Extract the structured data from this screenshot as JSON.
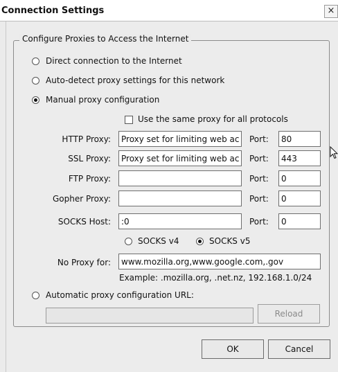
{
  "window": {
    "title": "Connection Settings",
    "close_glyph": "×"
  },
  "group_title": "Configure Proxies to Access the Internet",
  "options": {
    "direct": "Direct connection to the Internet",
    "autodetect": "Auto-detect proxy settings for this network",
    "manual": "Manual proxy configuration",
    "selected": "manual"
  },
  "same_proxy_label": "Use the same proxy for all protocols",
  "proxies": {
    "http": {
      "label": "HTTP Proxy:",
      "value": "Proxy set for limiting web ac",
      "port_label": "Port:",
      "port": "80"
    },
    "ssl": {
      "label": "SSL Proxy:",
      "value": "Proxy set for limiting web ac",
      "port_label": "Port:",
      "port": "443"
    },
    "ftp": {
      "label": "FTP Proxy:",
      "value": "",
      "port_label": "Port:",
      "port": "0"
    },
    "gopher": {
      "label": "Gopher Proxy:",
      "value": "",
      "port_label": "Port:",
      "port": "0"
    },
    "socks": {
      "label": "SOCKS Host:",
      "value": ":0",
      "port_label": "Port:",
      "port": "0"
    }
  },
  "socks_versions": {
    "v4": "SOCKS v4",
    "v5": "SOCKS v5",
    "selected": "v5"
  },
  "no_proxy": {
    "label": "No Proxy for:",
    "value": "www.mozilla.org,www.google.com,.gov",
    "example": "Example: .mozilla.org, .net.nz, 192.168.1.0/24"
  },
  "auto_config": {
    "label": "Automatic proxy configuration URL:",
    "value": "",
    "reload": "Reload"
  },
  "buttons": {
    "ok": "OK",
    "cancel": "Cancel"
  },
  "icons": {
    "close": "close-icon",
    "cursor": "mouse-cursor-icon"
  }
}
